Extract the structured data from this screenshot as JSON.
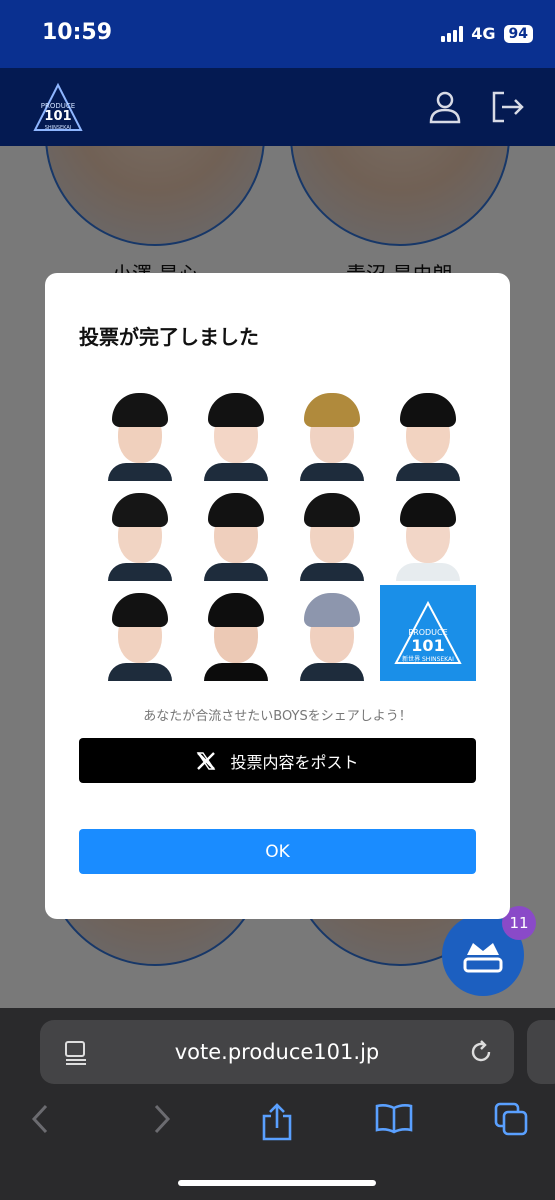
{
  "status": {
    "time": "10:59",
    "network": "4G",
    "battery": "94"
  },
  "background": {
    "names": [
      "小澤 昊心",
      "青沼 昊史朗"
    ]
  },
  "modal": {
    "title": "投票が完了しました",
    "share_text": "あなたが合流させたいBOYSをシェアしよう！",
    "post_button": "投票内容をポスト",
    "ok_button": "OK",
    "tiles": [
      {
        "hair": "#141414",
        "skin": "#f0d0bd",
        "body": "#1e2c3c"
      },
      {
        "hair": "#121212",
        "skin": "#f3d6c6",
        "body": "#1e2c3c"
      },
      {
        "hair": "#b08a3c",
        "skin": "#f0d2c2",
        "body": "#1e2c3c"
      },
      {
        "hair": "#101010",
        "skin": "#f2d3c1",
        "body": "#1e2c3c"
      },
      {
        "hair": "#161616",
        "skin": "#f1d4c3",
        "body": "#1e2c3c"
      },
      {
        "hair": "#121212",
        "skin": "#efcfbd",
        "body": "#1e2c3c"
      },
      {
        "hair": "#141414",
        "skin": "#f1d3c2",
        "body": "#1e2c3c"
      },
      {
        "hair": "#101010",
        "skin": "#f2d6c7",
        "body": "#e7ecef"
      },
      {
        "hair": "#121212",
        "skin": "#f1d2c0",
        "body": "#1e2c3c"
      },
      {
        "hair": "#0e0e0e",
        "skin": "#ecc9b5",
        "body": "#0c0c0c"
      },
      {
        "hair": "#8d96ad",
        "skin": "#f0d0bf",
        "body": "#1e2c3c"
      }
    ],
    "logo_tile_text": [
      "PRODUCE",
      "101",
      "新世界 SHINSEKAI"
    ]
  },
  "fab": {
    "badge_count": "11"
  },
  "browser": {
    "url": "vote.produce101.jp"
  },
  "colors": {
    "brand_blue": "#0a3090",
    "header_navy": "#041a52",
    "ok_blue": "#1a8cff",
    "logo_blue": "#1a8fe8"
  }
}
